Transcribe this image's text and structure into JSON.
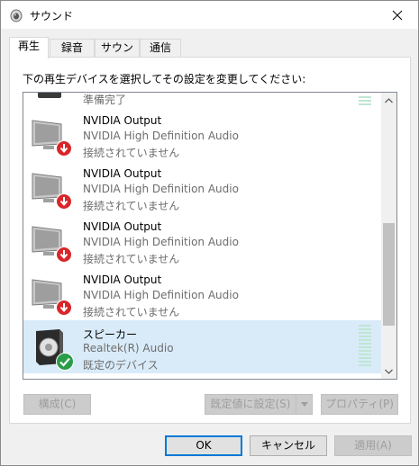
{
  "window": {
    "title": "サウンド",
    "close_icon": "close-icon",
    "app_icon": "speaker-app-icon"
  },
  "tabs": [
    {
      "label": "再生",
      "active": true
    },
    {
      "label": "録音",
      "active": false
    },
    {
      "label": "サウンド",
      "active": false
    },
    {
      "label": "通信",
      "active": false
    }
  ],
  "panel": {
    "instruction": "下の再生デバイスを選択してその設定を変更してください:"
  },
  "devices": [
    {
      "name": "",
      "driver": "",
      "status": "準備完了",
      "icon": "speaker-icon",
      "badge": "none",
      "selected": false
    },
    {
      "name": "NVIDIA Output",
      "driver": "NVIDIA High Definition Audio",
      "status": "接続されていません",
      "icon": "monitor-icon",
      "badge": "disconnected-arrow-icon",
      "selected": false
    },
    {
      "name": "NVIDIA Output",
      "driver": "NVIDIA High Definition Audio",
      "status": "接続されていません",
      "icon": "monitor-icon",
      "badge": "disconnected-arrow-icon",
      "selected": false
    },
    {
      "name": "NVIDIA Output",
      "driver": "NVIDIA High Definition Audio",
      "status": "接続されていません",
      "icon": "monitor-icon",
      "badge": "disconnected-arrow-icon",
      "selected": false
    },
    {
      "name": "NVIDIA Output",
      "driver": "NVIDIA High Definition Audio",
      "status": "接続されていません",
      "icon": "monitor-icon",
      "badge": "disconnected-arrow-icon",
      "selected": false
    },
    {
      "name": "スピーカー",
      "driver": "Realtek(R) Audio",
      "status": "既定のデバイス",
      "icon": "speaker-icon",
      "badge": "default-check-icon",
      "selected": true
    }
  ],
  "panel_buttons": {
    "configure": "構成(C)",
    "set_default": "既定値に設定(S)",
    "properties": "プロパティ(P)"
  },
  "dialog_buttons": {
    "ok": "OK",
    "cancel": "キャンセル",
    "apply": "適用(A)"
  },
  "colors": {
    "selection": "#d9ebf9",
    "accent": "#0078d7",
    "disconnected": "#d9262b",
    "default_check": "#2a9d48",
    "meter": "#bfe6d3"
  }
}
